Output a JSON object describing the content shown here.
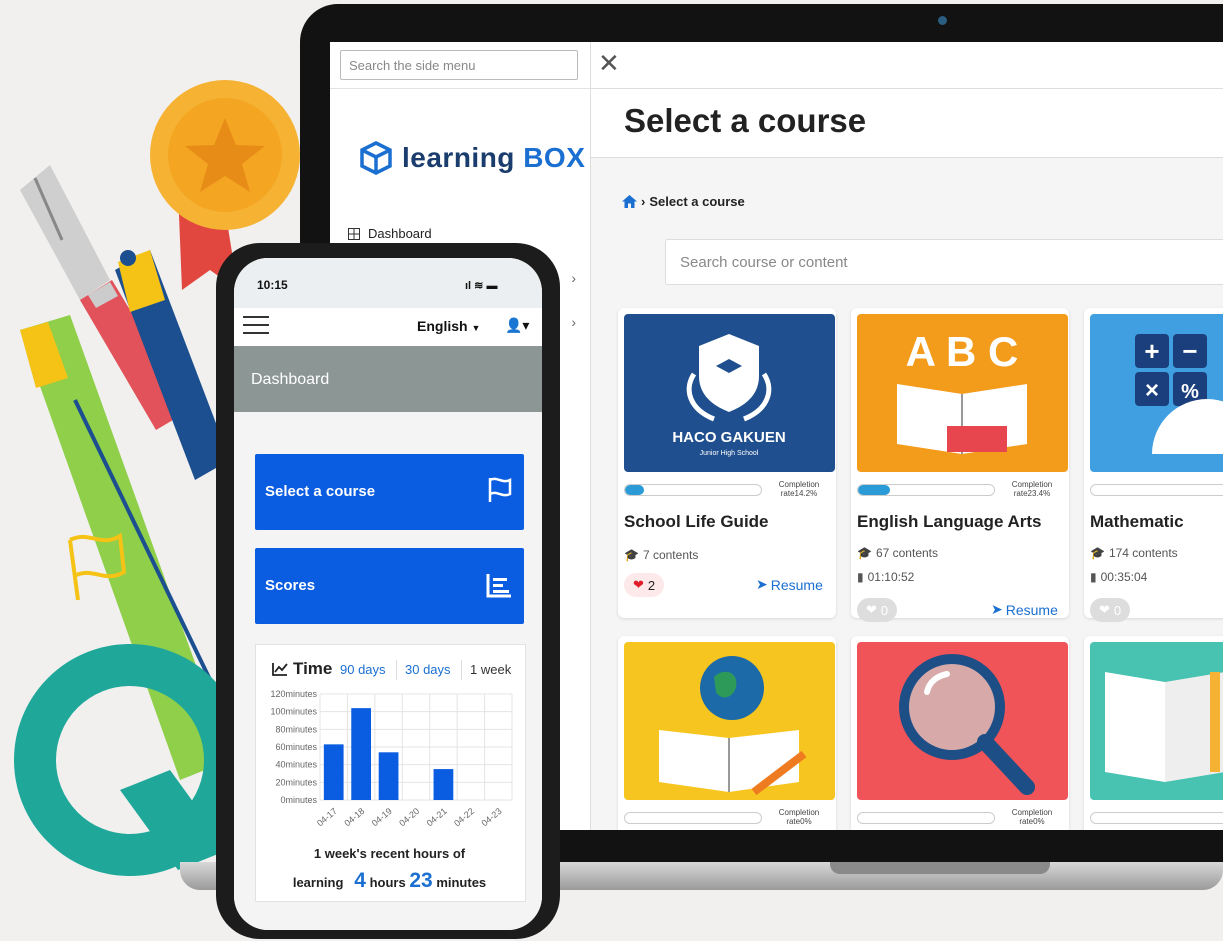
{
  "laptop": {
    "side_menu": {
      "search_placeholder": "Search the side menu",
      "logo_text_a": "learning",
      "logo_text_b": "BOX",
      "items": [
        {
          "label": "Dashboard",
          "icon": "grid-icon"
        }
      ]
    },
    "main": {
      "title": "Select a course",
      "breadcrumb": "Select a course",
      "search_placeholder": "Search course or content",
      "courses": [
        {
          "title": "School Life Guide",
          "completion": "Completion rate14.2%",
          "progress": 0.142,
          "contents": "7 contents",
          "duration": "",
          "likes": "2",
          "liked": true,
          "resume": "Resume",
          "thumb_text": "HACO GAKUEN",
          "thumb_sub": "Junior High School"
        },
        {
          "title": "English Language Arts",
          "completion": "Completion rate23.4%",
          "progress": 0.234,
          "contents": "67 contents",
          "duration": "01:10:52",
          "likes": "0",
          "liked": false,
          "resume": "Resume",
          "thumb_text": "A B C"
        },
        {
          "title": "Mathematic",
          "completion": "",
          "progress": 0.0,
          "contents": "174 contents",
          "duration": "00:35:04",
          "likes": "0",
          "liked": false,
          "resume": ""
        },
        {
          "title": "",
          "completion": "Completion rate0%",
          "progress": 0.0
        },
        {
          "title": "",
          "completion": "Completion rate0%",
          "progress": 0.0
        },
        {
          "title": "",
          "completion": "",
          "progress": 0.0
        }
      ]
    }
  },
  "phone": {
    "time": "10:15",
    "language": "English",
    "banner": "Dashboard",
    "buttons": {
      "select_course": "Select a course",
      "scores": "Scores"
    },
    "time_panel": {
      "title": "Time",
      "tabs": [
        "90 days",
        "30 days",
        "1 week"
      ],
      "recent_label": "1 week's recent hours of",
      "total_prefix": "learning",
      "hours": "4",
      "hours_unit": "hours",
      "minutes": "23",
      "minutes_unit": "minutes"
    },
    "chart_data": {
      "type": "bar",
      "categories": [
        "04-17",
        "04-18",
        "04-19",
        "04-20",
        "04-21",
        "04-22",
        "04-23"
      ],
      "values": [
        63,
        104,
        54,
        0,
        35,
        0,
        0
      ],
      "y_ticks": [
        "0minutes",
        "20minutes",
        "40minutes",
        "60minutes",
        "80minutes",
        "100minutes",
        "120minutes"
      ],
      "ylim": [
        0,
        120
      ],
      "color": "#0a5ce1",
      "grid": true
    }
  },
  "colors": {
    "primary": "#0a5ce1",
    "accent": "#1a6fd1",
    "progress": "#2b9bd8"
  }
}
